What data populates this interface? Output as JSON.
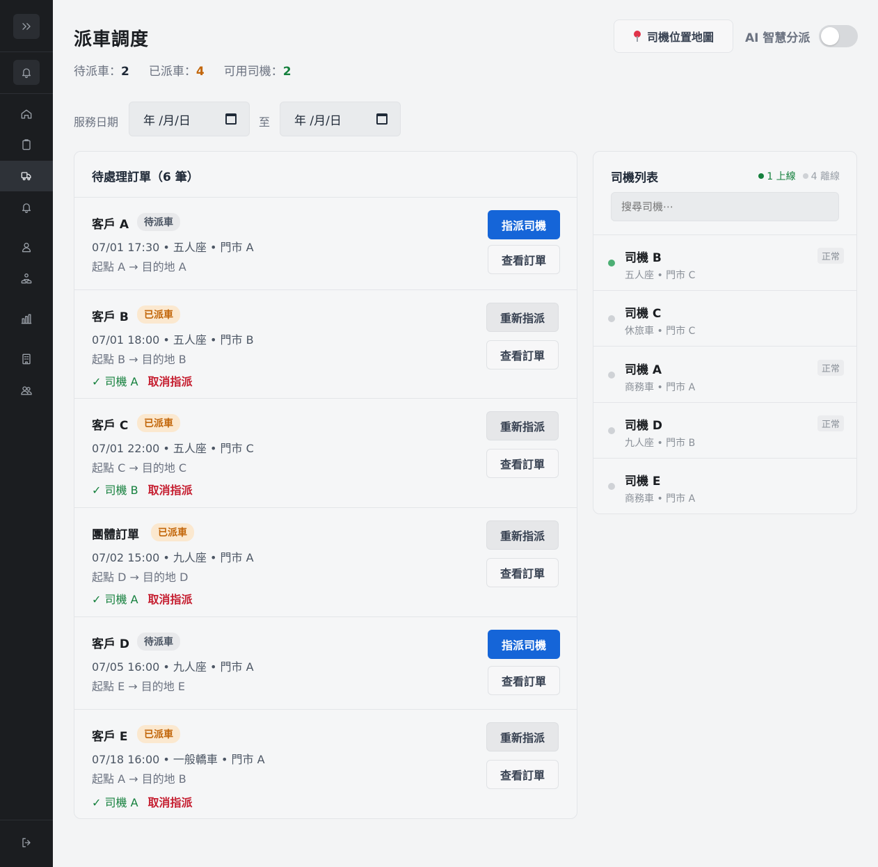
{
  "header": {
    "title": "派車調度",
    "stats": [
      {
        "label": "待派車：",
        "value": "2",
        "color": "#1f2937"
      },
      {
        "label": "已派車：",
        "value": "4",
        "color": "#c2660a"
      },
      {
        "label": "可用司機：",
        "value": "2",
        "color": "#15803d"
      }
    ],
    "map_button": "司機位置地圖",
    "ai_label": "AI 智慧分派",
    "ai_toggle_on": false
  },
  "filter": {
    "label": "服務日期",
    "to": "至",
    "start_value": "年 /月/日",
    "end_value": "年 /月/日"
  },
  "orders": {
    "title": "待處理訂單（6 筆）",
    "items": [
      {
        "name": "客戶 A",
        "status": "待派車",
        "meta": "07/01 17:30 • 五人座 • 門市 A",
        "route": "起點 A → 目的地 A",
        "driver": "",
        "cancel": "",
        "primary": "指派司機",
        "secondary": "查看訂單"
      },
      {
        "name": "客戶 B",
        "status": "已派車",
        "meta": "07/01 18:00 • 五人座 • 門市 B",
        "route": "起點 B → 目的地 B",
        "driver": "✓ 司機 A",
        "cancel": "取消指派",
        "primary": "重新指派",
        "secondary": "查看訂單"
      },
      {
        "name": "客戶 C",
        "status": "已派車",
        "meta": "07/01 22:00 • 五人座 • 門市 C",
        "route": "起點 C → 目的地 C",
        "driver": "✓ 司機 B",
        "cancel": "取消指派",
        "primary": "重新指派",
        "secondary": "查看訂單"
      },
      {
        "name": "團體訂單",
        "status": "已派車",
        "meta": "07/02 15:00 • 九人座 • 門市 A",
        "route": "起點 D → 目的地 D",
        "driver": "✓ 司機 A",
        "cancel": "取消指派",
        "primary": "重新指派",
        "secondary": "查看訂單"
      },
      {
        "name": "客戶 D",
        "status": "待派車",
        "meta": "07/05 16:00 • 九人座 • 門市 A",
        "route": "起點 E → 目的地 E",
        "driver": "",
        "cancel": "",
        "primary": "指派司機",
        "secondary": "查看訂單"
      },
      {
        "name": "客戶 E",
        "status": "已派車",
        "meta": "07/18 16:00 • 一般轎車 • 門市 A",
        "route": "起點 A → 目的地 B",
        "driver": "✓ 司機 A",
        "cancel": "取消指派",
        "primary": "重新指派",
        "secondary": "查看訂單"
      }
    ]
  },
  "drivers": {
    "title": "司機列表",
    "online_label": "1 上線",
    "offline_label": "4 離線",
    "search_placeholder": "搜尋司機⋯",
    "items": [
      {
        "name": "司機 B",
        "meta": "五人座 • 門市 C",
        "status": "正常",
        "online": true
      },
      {
        "name": "司機 C",
        "meta": "休旅車 • 門市 C",
        "status": "",
        "online": false
      },
      {
        "name": "司機 A",
        "meta": "商務車 • 門市 A",
        "status": "正常",
        "online": false
      },
      {
        "name": "司機 D",
        "meta": "九人座 • 門市 B",
        "status": "正常",
        "online": false
      },
      {
        "name": "司機 E",
        "meta": "商務車 • 門市 A",
        "status": "",
        "online": false
      }
    ]
  },
  "sidebar": {
    "icons": [
      "expand-icon",
      "bell-icon",
      "home-icon",
      "clipboard-icon",
      "dispatch-car-icon",
      "notification-icon",
      "user-icon",
      "team-icon",
      "chart-icon",
      "building-icon",
      "users-icon",
      "logout-icon"
    ]
  }
}
